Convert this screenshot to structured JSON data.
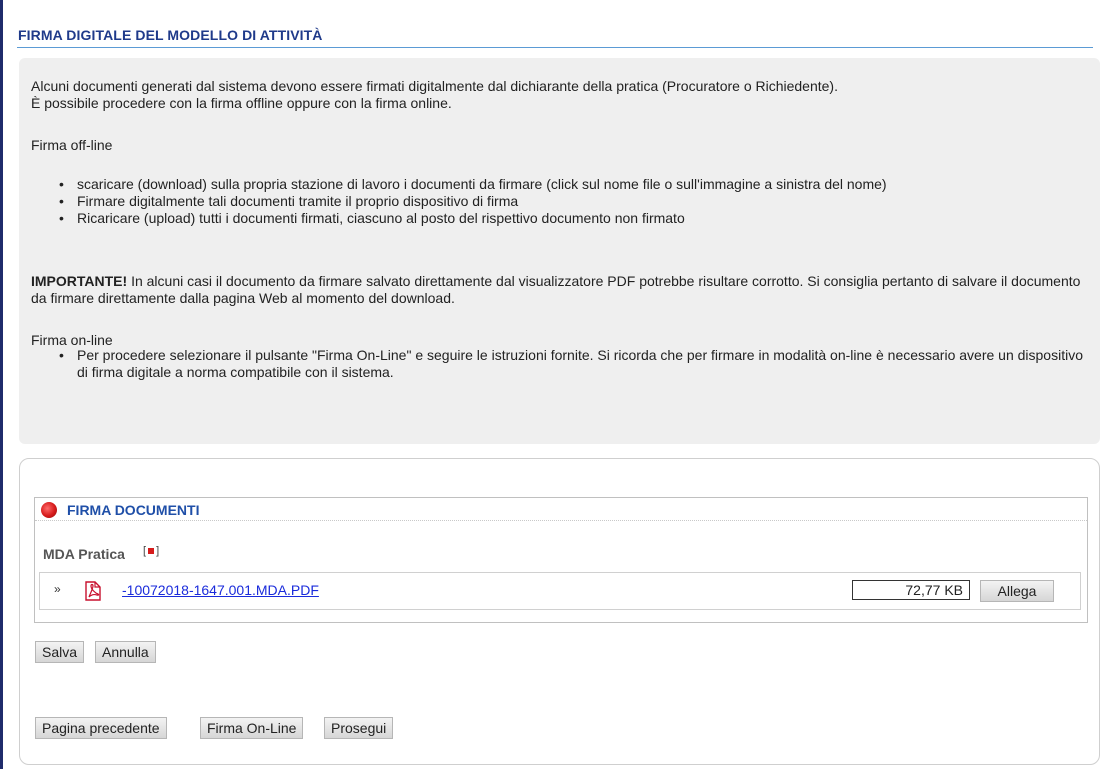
{
  "header": {
    "title": "FIRMA DIGITALE DEL MODELLO DI ATTIVITÀ"
  },
  "info": {
    "intro_line1": "Alcuni documenti generati dal sistema devono essere firmati digitalmente dal dichiarante della pratica (Procuratore o Richiedente).",
    "intro_line2": "È possibile procedere con la firma offline oppure con la firma online.",
    "offline_title": "Firma off-line",
    "offline_items": [
      "scaricare (download) sulla propria stazione di lavoro i documenti da firmare (click sul nome file o sull'immagine a sinistra del nome)",
      "Firmare digitalmente tali documenti tramite il proprio dispositivo di firma",
      "Ricaricare (upload) tutti i documenti firmati, ciascuno al posto del rispettivo documento non firmato"
    ],
    "important_label": "IMPORTANTE!",
    "important_text": " In alcuni casi il documento da firmare salvato direttamente dal visualizzatore PDF potrebbe risultare corrotto. Si consiglia pertanto di salvare il documento da firmare direttamente dalla pagina Web al momento del download.",
    "online_title": "Firma on-line",
    "online_items": [
      "Per procedere selezionare il pulsante \"Firma On-Line\" e seguire le istruzioni fornite. Si ricorda che per firmare in modalità on-line è necessario avere un dispositivo di firma digitale a norma compatibile con il sistema."
    ]
  },
  "sign_panel": {
    "title": "FIRMA DOCUMENTI",
    "mda_label": "MDA Pratica",
    "required_mark": "[ ]",
    "file": {
      "name": "-10072018-1647.001.MDA.PDF",
      "size": "72,77 KB",
      "attach_label": "Allega"
    }
  },
  "buttons": {
    "save": "Salva",
    "cancel": "Annulla",
    "previous": "Pagina precedente",
    "sign_online": "Firma On-Line",
    "continue": "Prosegui"
  },
  "colors": {
    "header_text": "#1f3a8a",
    "link": "#1a2bdb",
    "info_bg": "#efefef",
    "status_dot": "#d61b1b"
  },
  "icons": [
    "chevron-down-icon",
    "pdf-icon",
    "red-status-dot-icon"
  ]
}
